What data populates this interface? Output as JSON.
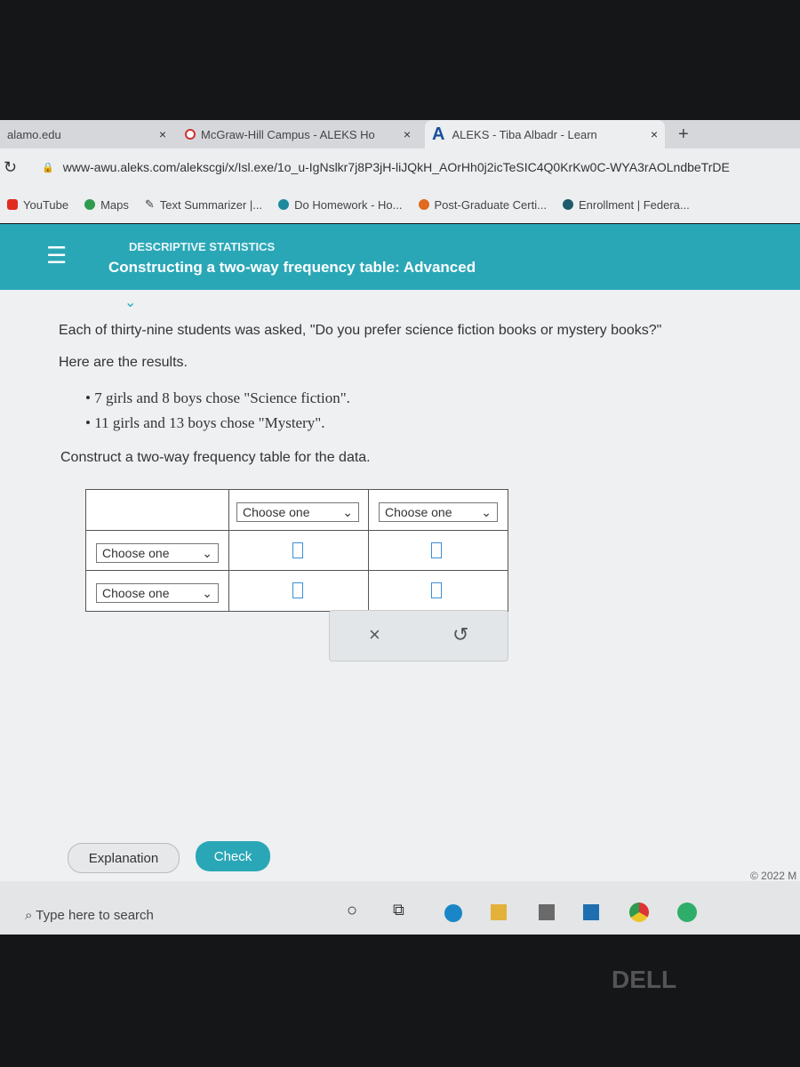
{
  "browser": {
    "tabs": [
      {
        "label": "alamo.edu"
      },
      {
        "label": "McGraw-Hill Campus - ALEKS Ho"
      },
      {
        "label": "ALEKS - Tiba Albadr - Learn",
        "active": true
      }
    ],
    "new_tab": "+",
    "close": "×",
    "url": "www-awu.aleks.com/alekscgi/x/Isl.exe/1o_u-IgNslkr7j8P3jH-liJQkH_AOrHh0j2icTeSIC4Q0KrKw0C-WYA3rAOLndbeTrDE",
    "bookmarks": [
      {
        "label": "YouTube",
        "color": "#e02b20"
      },
      {
        "label": "Maps",
        "color": "#2e9b4e"
      },
      {
        "label": "Text Summarizer |...",
        "color": "#888888"
      },
      {
        "label": "Do Homework - Ho...",
        "color": "#1d8a9c"
      },
      {
        "label": "Post-Graduate Certi...",
        "color": "#e06a1f"
      },
      {
        "label": "Enrollment | Federa...",
        "color": "#1f5a6b"
      }
    ]
  },
  "header": {
    "category": "DESCRIPTIVE STATISTICS",
    "title": "Constructing a two-way frequency table: Advanced",
    "color": "#2aa7b7"
  },
  "problem": {
    "intro": "Each of thirty-nine students was asked, \"Do you prefer science fiction books or mystery books?\"",
    "results_label": "Here are the results.",
    "bullets": [
      "7 girls and 8 boys chose \"Science fiction\".",
      "11 girls and 13 boys chose \"Mystery\"."
    ],
    "instruction": "Construct a two-way frequency table for the data."
  },
  "table": {
    "col_selects": [
      "Choose one",
      "Choose one"
    ],
    "row_selects": [
      "Choose one",
      "Choose one"
    ]
  },
  "tools": {
    "clear": "×",
    "undo": "↺"
  },
  "buttons": {
    "explanation": "Explanation",
    "check": "Check"
  },
  "copyright": "© 2022 M",
  "taskbar": {
    "search_placeholder": "Type here to search"
  },
  "brand": "DELL"
}
